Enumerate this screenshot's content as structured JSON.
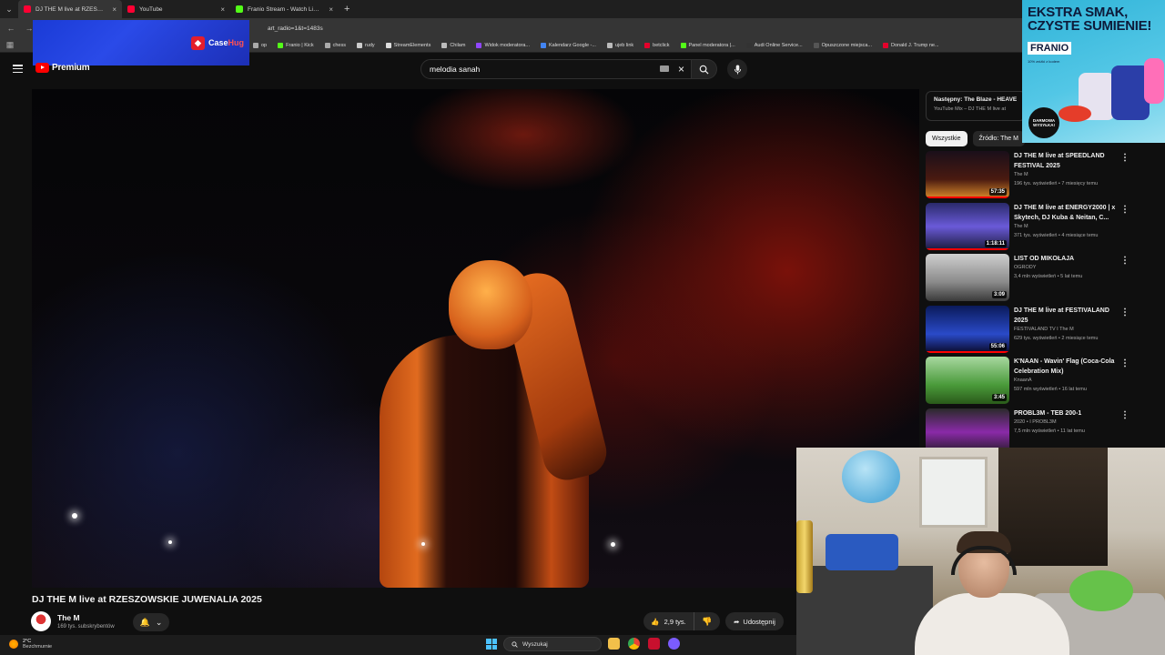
{
  "browser": {
    "tabs": [
      {
        "title": "DJ THE M live at RZESZOWSKIE",
        "favicon_color": "#ff0033",
        "active": true
      },
      {
        "title": "YouTube",
        "favicon_color": "#ff0033",
        "active": false
      },
      {
        "title": "Franio Stream - Watch Live on",
        "favicon_color": "#53fc18",
        "active": false
      }
    ],
    "new_tab": "+",
    "url": "art_radio=1&t=1483s",
    "bookmarks": [
      {
        "label": "op",
        "color": "#aaa"
      },
      {
        "label": "Franio | Kick",
        "color": "#53fc18"
      },
      {
        "label": "chess",
        "color": "#aaaaaa"
      },
      {
        "label": "rudy",
        "color": "#cccccc"
      },
      {
        "label": "StreamElements",
        "color": "#dddddd"
      },
      {
        "label": "Chilam",
        "color": "#bbbbbb"
      },
      {
        "label": "Widok moderatora...",
        "color": "#9146ff"
      },
      {
        "label": "Kalendarz Google -...",
        "color": "#4285f4"
      },
      {
        "label": "ujeb link",
        "color": "#bbbbbb"
      },
      {
        "label": "betclick",
        "color": "#e4002b"
      },
      {
        "label": "Panel moderatora |...",
        "color": "#53fc18"
      },
      {
        "label": "Audi Online Service...",
        "color": "#333333"
      },
      {
        "label": "Opuszczone miejsca...",
        "color": "#555555"
      },
      {
        "label": "Donald J. Trump ne...",
        "color": "#e4002b"
      }
    ]
  },
  "overlay": {
    "brand_a": "Case",
    "brand_b": "Hug"
  },
  "youtube": {
    "logo_text": "Premium",
    "search_value": "melodia sanah",
    "clear_icon": "×"
  },
  "video": {
    "title": "DJ THE M live at RZESZOWSKIE JUWENALIA 2025",
    "channel": "The M",
    "subscribers": "169 tys. subskrybentów",
    "likes": "2,9 tys.",
    "share_label": "Udostępnij"
  },
  "sidebar": {
    "next_label": "Następny: The Blaze - HEAVE",
    "next_sub": "YouTube Mix – DJ THE M live at",
    "chips": [
      "Wszystkie",
      "Źródło: The M"
    ],
    "recommendations": [
      {
        "title": "DJ THE M live at SPEEDLAND FESTIVAL 2025",
        "channel": "The M",
        "meta": "196 tys. wyświetleń • 7 miesięcy temu",
        "duration": "57:35",
        "progress": 1.0,
        "thumb": "linear-gradient(180deg,#1a0f1a,#4a1a10 60%,#d98a2a)"
      },
      {
        "title": "DJ THE M live at ENERGY2000 | x Skytech, DJ Kuba & Neitan, C...",
        "channel": "The M",
        "meta": "371 tys. wyświetleń • 4 miesiące temu",
        "duration": "1:18:11",
        "progress": 1.0,
        "thumb": "linear-gradient(180deg,#2a2a6a,#6a5ad8 50%,#1a1a3a)"
      },
      {
        "title": "LIST OD MIKOŁAJA",
        "channel": "OGRODY",
        "meta": "3,4 mln wyświetleń • 5 lat temu",
        "duration": "3:09",
        "progress": 0,
        "thumb": "linear-gradient(180deg,#cfcfcf,#8a8a8a 60%,#3a3a3a)"
      },
      {
        "title": "DJ THE M live at FESTIVALAND 2025",
        "channel": "FESTIVALAND TV I The M",
        "meta": "629 tys. wyświetleń • 2 miesiące temu",
        "duration": "55:06",
        "progress": 1.0,
        "thumb": "linear-gradient(180deg,#0a1a5a,#2a4ac8 60%,#0a0a2a)"
      },
      {
        "title": "K'NAAN - Wavin' Flag (Coca-Cola Celebration Mix)",
        "channel": "KnaanA",
        "meta": "597 mln wyświetleń • 16 lat temu",
        "duration": "3:45",
        "progress": 0,
        "thumb": "linear-gradient(180deg,#a8d8a0,#4a9a3a 60%,#2a5a1a)"
      },
      {
        "title": "PROBL3M - TEB 200-1",
        "channel": "2020 • I PROBL3M",
        "meta": "7,5 mln wyświetleń • 11 lat temu",
        "duration": "",
        "progress": 0,
        "thumb": "linear-gradient(180deg,#2a2a2a,#8a2aa8 50%,#1a1a1a)"
      }
    ]
  },
  "ad": {
    "headline_1": "EKSTRA SMAK,",
    "headline_2": "CZYSTE SUMIENIE!",
    "brand": "FRANIO",
    "fineprint": "10% zniżki z kodem",
    "badge": "DARMOWA WYSYŁKA!"
  },
  "taskbar": {
    "temp": "2°C",
    "weather": "Bezchmurnie",
    "search_placeholder": "Wyszukaj"
  }
}
